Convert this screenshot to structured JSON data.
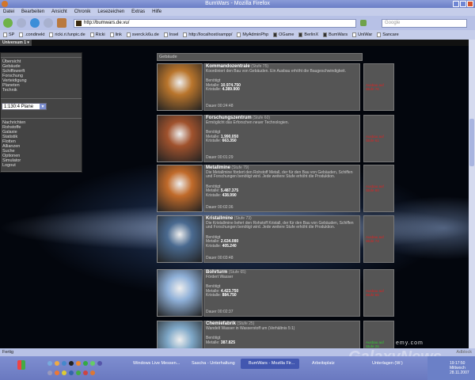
{
  "window": {
    "title": "BumWars - Mozilla Firefox"
  },
  "menu": [
    "Datei",
    "Bearbeiten",
    "Ansicht",
    "Chronik",
    "Lesezeichen",
    "Extras",
    "Hilfe"
  ],
  "nav": {
    "url": "http://bumwars.de.vu/",
    "search_placeholder": "Google"
  },
  "bookmarks": [
    "SP",
    ".condinekt",
    "ricki.ri.funpic.de",
    "Ricki",
    "link",
    "sverck.k6u.de",
    "Insel",
    "http://localhost/xampp/",
    "MyAdminPhp",
    "OGame",
    "BerlinX",
    "BumWars",
    "UniWar",
    "Sancare"
  ],
  "tab": "Universum 1 ▾",
  "sidebar": {
    "group1": [
      "Übersicht",
      "Gebäude",
      "Schiffswerft",
      "Forschung",
      "Verteidigung",
      "Planeten",
      "Technik"
    ],
    "planet_select": "1:130:4 Plane",
    "group2": [
      "Nachrichten",
      "Rohstoffe",
      "Galaxie",
      "Statistik",
      "Flotten",
      "Allianzen",
      "Suche",
      "Optionen",
      "Simulator",
      "Logout"
    ]
  },
  "main": {
    "header": "Gebäude",
    "need_label": "Benötigt",
    "metal_label": "Metalle:",
    "crystal_label": "Kristalle:",
    "buildings": [
      {
        "name": "Kommandozentrale",
        "level": "(Stufe 75)",
        "desc": "Koordiniert den Bau von Gebäuden. Ein Ausbau erhöht die Baugeschwindigkeit.",
        "metal": "10.974.750",
        "crystal": "4.389.900",
        "duration": "Dauer 00:24:48",
        "action": "Ausbau auf Stufe 76",
        "ok": false,
        "color": "#b9752c"
      },
      {
        "name": "Forschungszentrum",
        "level": "(Stufe 60)",
        "desc": "Ermöglicht das Erforschen neuer Technologien.",
        "metal": "1.990.050",
        "crystal": "663.350",
        "duration": "Dauer 00:01:29",
        "action": "Ausbau auf Stufe 61",
        "ok": false,
        "color": "#a0522d"
      },
      {
        "name": "Metallmine",
        "level": "(Stufe 79)",
        "desc": "Die Metallmine fördert den Rohstoff Metall, der für den Bau von Gebäuden, Schiffen und Forschungen benötigt wird. Jede weitere Stufe erhöht die Produktion.",
        "metal": "5.487.375",
        "crystal": "438.990",
        "duration": "Dauer 00:02:36",
        "action": "Ausbau auf Stufe 80",
        "ok": false,
        "color": "#c06a2a"
      },
      {
        "name": "Kristallmine",
        "level": "(Stufe 73)",
        "desc": "Die Kristallmine liefert den Rohstoff Kristall, der für den Bau von Gebäuden, Schiffen und Forschungen benötigt wird. Jede weitere Stufe erhöht die Produktion.",
        "metal": "2.634.080",
        "crystal": "405.240",
        "duration": "Dauer 00:03:48",
        "action": "Ausbau auf Stufe 74",
        "ok": false,
        "color": "#4a6a90"
      },
      {
        "name": "Bohrturm",
        "level": "(Stufe 65)",
        "desc": "Fördert Wasser",
        "metal": "4.423.750",
        "crystal": "884.750",
        "duration": "Dauer 00:02:37",
        "action": "Ausbau auf Stufe 66",
        "ok": false,
        "color": "#8fb0d8"
      },
      {
        "name": "Chemiefabrik",
        "level": "(Stufe 25)",
        "desc": "Wandelt Wasser in Wasserstoff um (Verhältnis 5:1)",
        "metal": "387.825",
        "crystal": "",
        "duration": "",
        "action": "Ausbau auf Stufe 26",
        "ok": true,
        "color": "#7fa8c8"
      }
    ]
  },
  "status": {
    "left": "Fertig",
    "right": "Adblock"
  },
  "taskbar": {
    "buttons": [
      "Windows Live Messen...",
      "Sascha - Unterhaltung",
      "BumWars - Mozilla Fir...",
      "Arbeitsplatz",
      "Unterlagen (W:)"
    ],
    "time": "19:17:50",
    "day": "Mittwoch",
    "date": "28.11.2007"
  },
  "watermark": "GalaxyNews",
  "site_fragment": "emy.com"
}
